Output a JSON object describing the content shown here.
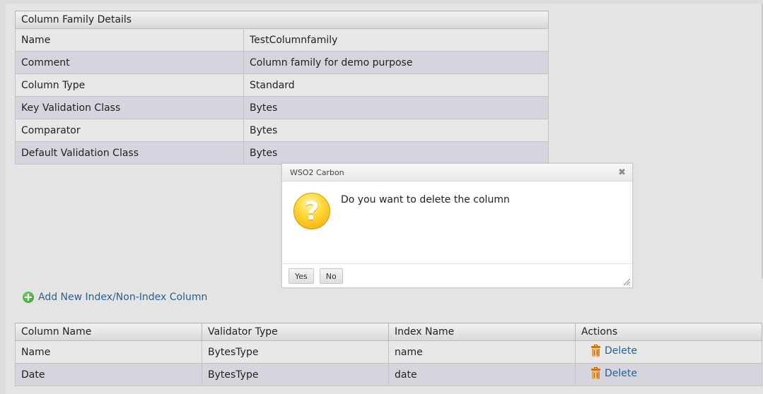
{
  "details": {
    "header": "Column Family Details",
    "rows": [
      {
        "key": "Name",
        "value": "TestColumnfamily"
      },
      {
        "key": "Comment",
        "value": "Column family for demo purpose"
      },
      {
        "key": "Column Type",
        "value": "Standard"
      },
      {
        "key": "Key Validation Class",
        "value": "Bytes"
      },
      {
        "key": "Comparator",
        "value": "Bytes"
      },
      {
        "key": "Default Validation Class",
        "value": "Bytes"
      }
    ]
  },
  "add_link": {
    "label": "Add New Index/Non-Index Column",
    "icon": "plus-circle-icon"
  },
  "columns": {
    "headers": [
      "Column Name",
      "Validator Type",
      "Index Name",
      "Actions"
    ],
    "rows": [
      {
        "column_name": "Name",
        "validator_type": "BytesType",
        "index_name": "name",
        "action_label": "Delete"
      },
      {
        "column_name": "Date",
        "validator_type": "BytesType",
        "index_name": "date",
        "action_label": "Delete"
      }
    ]
  },
  "dialog": {
    "title": "WSO2 Carbon",
    "message": "Do you want to delete the column",
    "yes_label": "Yes",
    "no_label": "No",
    "icon": "question-icon",
    "close_icon": "close-icon"
  },
  "colors": {
    "link": "#2c5e8f",
    "row_odd": "#e8e8e8",
    "row_even": "#d5d5dd"
  }
}
